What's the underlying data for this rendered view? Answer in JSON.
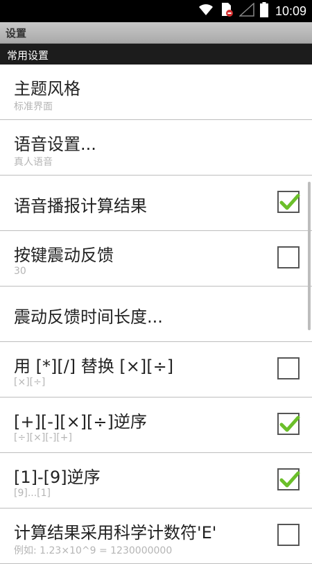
{
  "status_bar": {
    "time": "10:09",
    "icons": [
      "wifi-icon",
      "sim-error-icon",
      "signal-icon",
      "battery-icon"
    ]
  },
  "title_bar": {
    "title": "设置"
  },
  "section": {
    "title": "常用设置"
  },
  "items": [
    {
      "title": "主题风格",
      "summary": "标准界面"
    },
    {
      "title": "语音设置...",
      "summary": "真人语音"
    },
    {
      "title": "语音播报计算结果",
      "checked": true
    },
    {
      "title": "按键震动反馈",
      "summary": "30",
      "checked": false
    },
    {
      "title": "震动反馈时间长度..."
    },
    {
      "title": "用 [*][/] 替换 [×][÷]",
      "summary": "[×][÷]",
      "checked": false
    },
    {
      "title": "[+][-][×][÷]逆序",
      "summary": "[÷][×][-][+]",
      "checked": true
    },
    {
      "title": "[1]-[9]逆序",
      "summary": "[9]...[1]",
      "checked": true
    },
    {
      "title": "计算结果采用科学计数符'E'",
      "summary": "例如: 1.23×10^9 = 1230000000",
      "checked": false
    }
  ],
  "colors": {
    "check": "#6bbf2a",
    "section_bg": "#1c1c1c",
    "divider": "#bdbdbd"
  }
}
